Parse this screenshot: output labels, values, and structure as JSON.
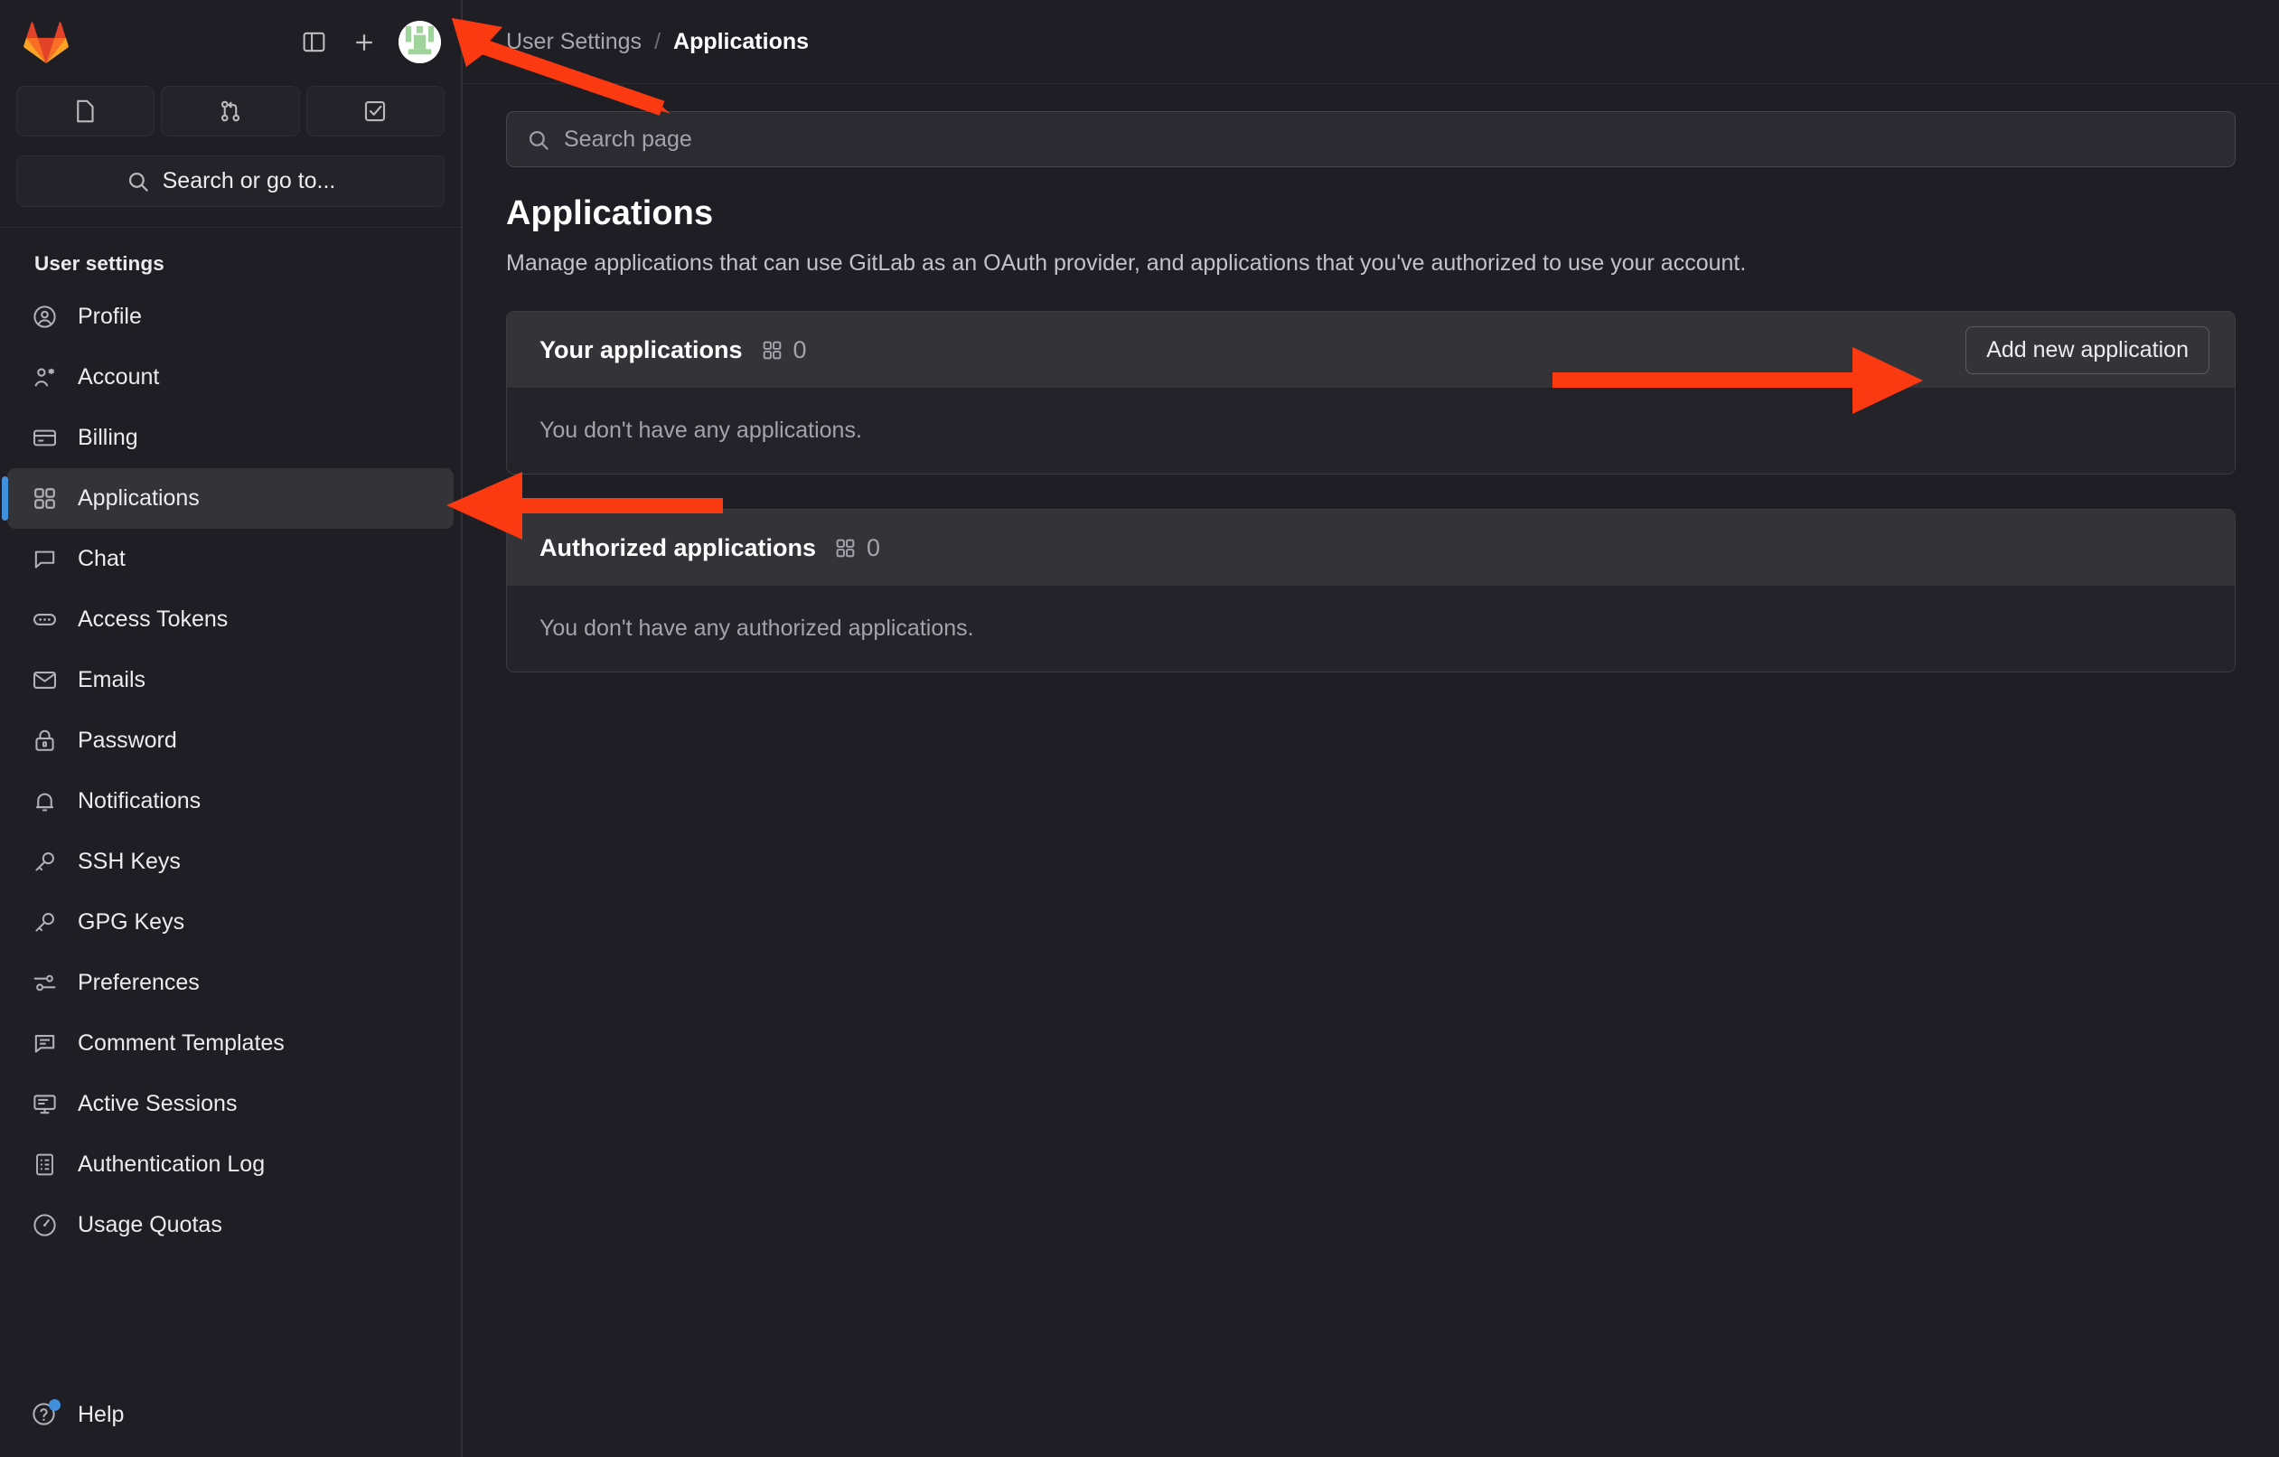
{
  "colors": {
    "accent_blue": "#428fdc",
    "annotation_red": "#fc3a12",
    "sidebar_bg": "#1f1e24",
    "card_header_bg": "#333338",
    "avatar_green": "#9fd49a"
  },
  "sidebar": {
    "logo": "gitlab-logo",
    "top_actions": [
      {
        "name": "toggle-sidebar-icon",
        "label": ""
      },
      {
        "name": "create-new-icon",
        "label": ""
      },
      {
        "name": "user-avatar",
        "label": ""
      }
    ],
    "quick_actions": [
      {
        "name": "issues-icon",
        "label": ""
      },
      {
        "name": "merge-requests-icon",
        "label": ""
      },
      {
        "name": "todos-icon",
        "label": ""
      }
    ],
    "search": {
      "placeholder": "Search or go to..."
    },
    "section_title": "User settings",
    "items": [
      {
        "label": "Profile",
        "icon": "user-circle-icon",
        "active": false
      },
      {
        "label": "Account",
        "icon": "account-icon",
        "active": false
      },
      {
        "label": "Billing",
        "icon": "credit-card-icon",
        "active": false
      },
      {
        "label": "Applications",
        "icon": "applications-icon",
        "active": true
      },
      {
        "label": "Chat",
        "icon": "chat-bubble-icon",
        "active": false
      },
      {
        "label": "Access Tokens",
        "icon": "token-icon",
        "active": false
      },
      {
        "label": "Emails",
        "icon": "envelope-icon",
        "active": false
      },
      {
        "label": "Password",
        "icon": "lock-icon",
        "active": false
      },
      {
        "label": "Notifications",
        "icon": "bell-icon",
        "active": false
      },
      {
        "label": "SSH Keys",
        "icon": "key-icon",
        "active": false
      },
      {
        "label": "GPG Keys",
        "icon": "key-icon",
        "active": false
      },
      {
        "label": "Preferences",
        "icon": "sliders-icon",
        "active": false
      },
      {
        "label": "Comment Templates",
        "icon": "comment-lines-icon",
        "active": false
      },
      {
        "label": "Active Sessions",
        "icon": "monitor-icon",
        "active": false
      },
      {
        "label": "Authentication Log",
        "icon": "log-list-icon",
        "active": false
      },
      {
        "label": "Usage Quotas",
        "icon": "gauge-icon",
        "active": false
      }
    ],
    "help": {
      "label": "Help",
      "icon": "help-circle-icon",
      "has_notification_dot": true
    }
  },
  "breadcrumb": {
    "parent": "User Settings",
    "separator": "/",
    "current": "Applications"
  },
  "main": {
    "page_search": {
      "placeholder": "Search page",
      "value": "",
      "icon": "search-icon"
    },
    "title": "Applications",
    "description": "Manage applications that can use GitLab as an OAuth provider, and applications that you've authorized to use your account.",
    "cards": [
      {
        "title": "Your applications",
        "count": "0",
        "count_icon": "applications-icon",
        "action_label": "Add new application",
        "empty_text": "You don't have any applications."
      },
      {
        "title": "Authorized applications",
        "count": "0",
        "count_icon": "applications-icon",
        "action_label": "",
        "empty_text": "You don't have any authorized applications."
      }
    ]
  },
  "annotations": [
    {
      "name": "arrow-to-avatar",
      "points_to": "user-avatar"
    },
    {
      "name": "arrow-to-applications",
      "points_to": "sidebar-item-applications"
    },
    {
      "name": "arrow-to-add-new",
      "points_to": "add-new-application-button"
    }
  ]
}
